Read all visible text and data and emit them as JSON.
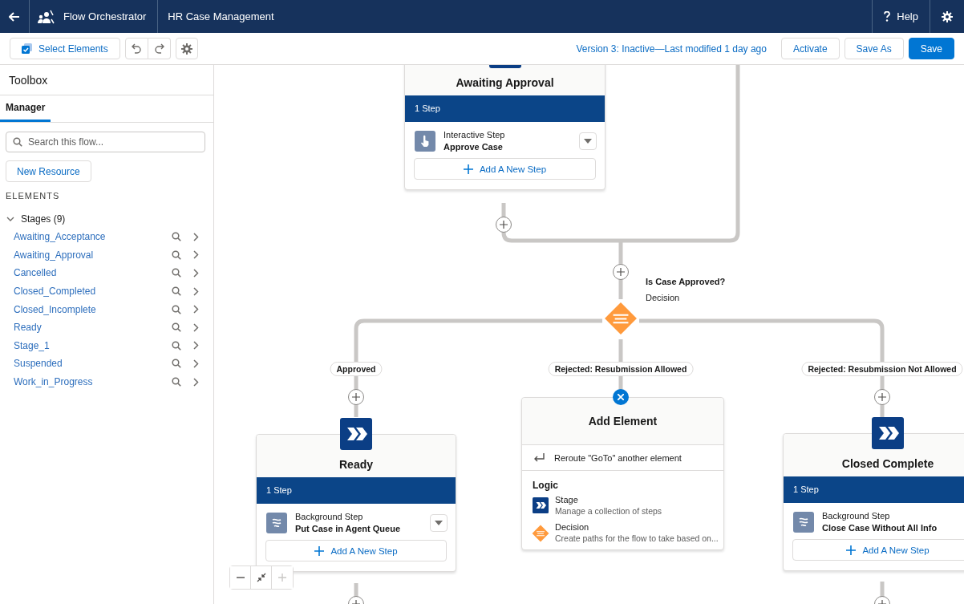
{
  "header": {
    "app_name": "Flow Orchestrator",
    "flow_name": "HR Case Management",
    "help": "Help"
  },
  "toolbar": {
    "select_elements": "Select Elements",
    "status": "Version 3: Inactive—Last modified 1 day ago",
    "buttons": [
      {
        "label": "Activate",
        "kind": "neutral"
      },
      {
        "label": "Save As",
        "kind": "neutral"
      },
      {
        "label": "Save",
        "kind": "brand"
      }
    ]
  },
  "sidebar": {
    "title": "Toolbox",
    "tabs": [
      {
        "label": "Manager",
        "selected": true
      }
    ],
    "search": {
      "placeholder": "Search this flow..."
    },
    "new_resource": "New Resource",
    "section": "ELEMENTS",
    "group": {
      "label": "Stages (9)",
      "expanded": true,
      "items": [
        "Awaiting_Acceptance",
        "Awaiting_Approval",
        "Cancelled",
        "Closed_Completed",
        "Closed_Incomplete",
        "Ready",
        "Stage_1",
        "Suspended",
        "Work_in_Progress"
      ]
    }
  },
  "canvas": {
    "stages": [
      {
        "title": "Awaiting Approval",
        "step_count": "1 Step",
        "steps": [
          {
            "kind": "interactive",
            "type": "Interactive Step",
            "name": "Approve Case"
          }
        ],
        "add_step": "Add A New Step"
      },
      {
        "title": "Ready",
        "step_count": "1 Step",
        "steps": [
          {
            "kind": "background",
            "type": "Background Step",
            "name": "Put Case in Agent Queue"
          }
        ],
        "add_step": "Add A New Step"
      },
      {
        "title": "Closed Complete",
        "step_count": "1 Step",
        "steps": [
          {
            "kind": "background",
            "type": "Background Step",
            "name": "Close Case Without All Info"
          }
        ],
        "add_step": "Add A New Step"
      }
    ],
    "decision": {
      "name": "Is Case Approved?",
      "type": "Decision"
    },
    "outcomes": [
      "Approved",
      "Rejected: Resubmission Allowed",
      "Rejected: Resubmission Not Allowed"
    ],
    "add_element": {
      "title": "Add Element",
      "reroute": "Reroute \"GoTo\" another element",
      "section": "Logic",
      "options": [
        {
          "kind": "stage",
          "name": "Stage",
          "description": "Manage a collection of steps"
        },
        {
          "kind": "decision",
          "name": "Decision",
          "description": "Create paths for the flow to take based on..."
        }
      ]
    }
  }
}
